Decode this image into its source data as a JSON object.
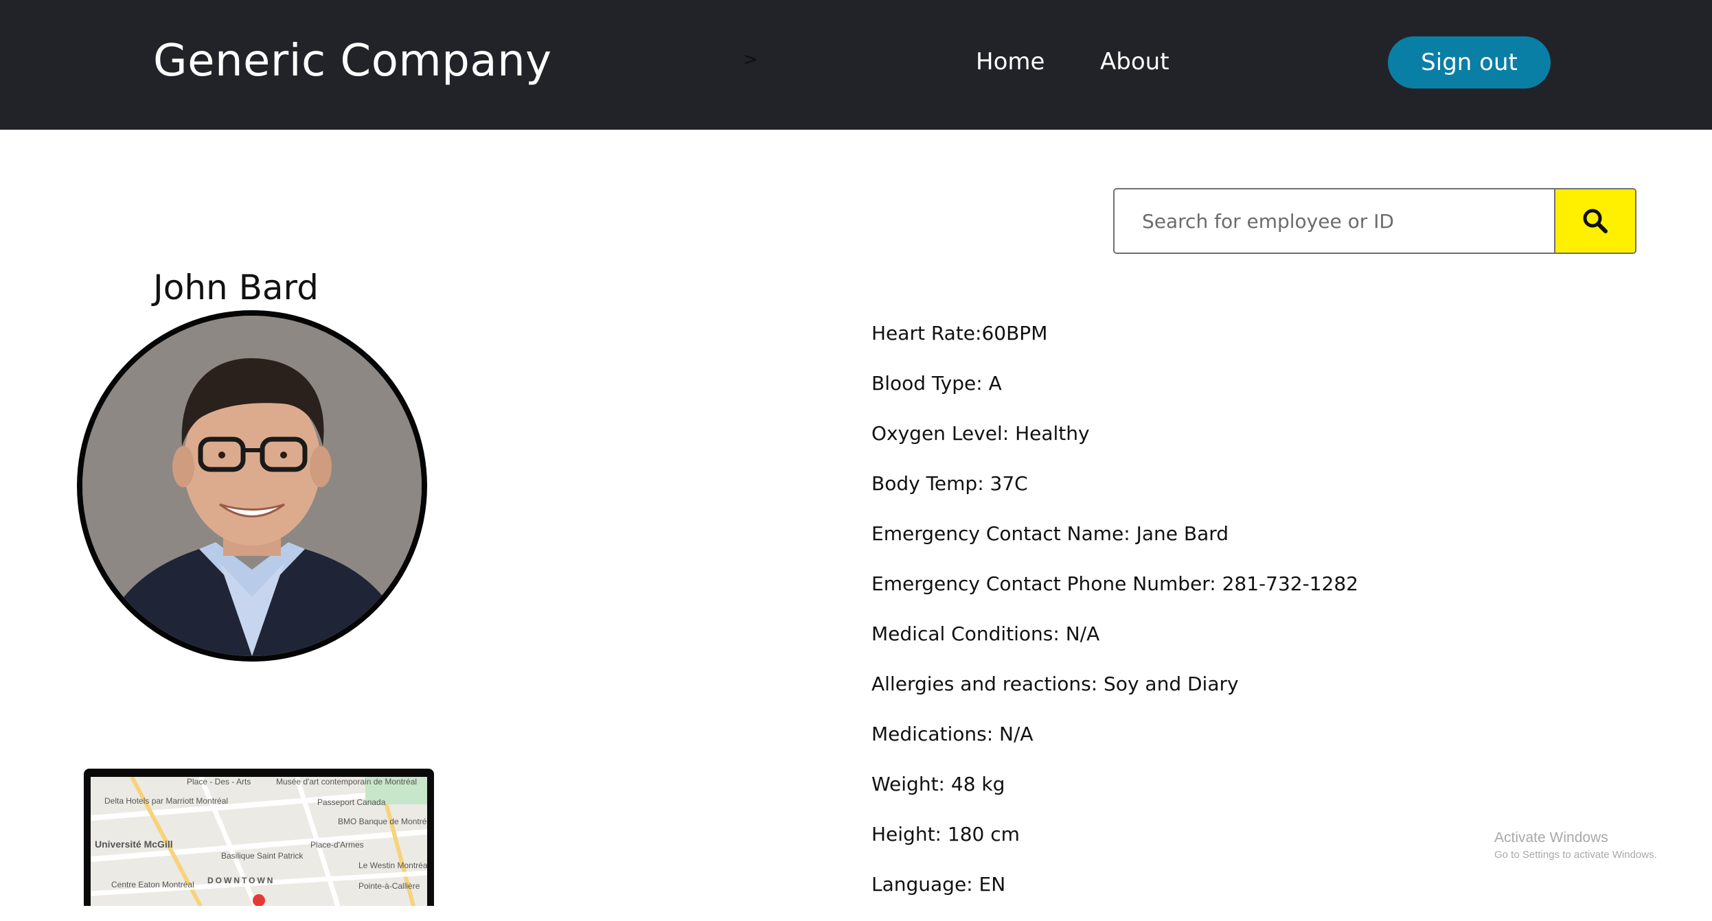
{
  "header": {
    "brand": "Generic Company",
    "caret": ">",
    "nav": [
      {
        "label": "Home"
      },
      {
        "label": "About"
      }
    ],
    "signout_label": "Sign out"
  },
  "search": {
    "placeholder": "Search for employee or ID",
    "button_icon": "search-icon"
  },
  "employee": {
    "name": "John Bard",
    "details": [
      "Heart Rate:60BPM",
      "Blood Type: A",
      "Oxygen Level: Healthy",
      "Body Temp: 37C",
      "Emergency Contact Name: Jane Bard",
      "Emergency Contact Phone Number: 281-732-1282",
      "Medical Conditions: N/A",
      "Allergies and reactions: Soy and Diary",
      "Medications: N/A",
      "Weight: 48 kg",
      "Height: 180 cm",
      "Language: EN"
    ]
  },
  "map": {
    "labels": [
      "Place - Des - Arts",
      "Musée d'art contemporain de Montréal",
      "Delta Hotels par Marriott Montréal",
      "Passeport Canada",
      "BMO Banque de Montréal",
      "Université McGill",
      "Basilique Saint Patrick",
      "Place-d'Armes",
      "Le Westin Montréal",
      "Centre Eaton Montréal",
      "DOWNTOWN",
      "Pointe-à-Callière"
    ]
  },
  "watermark": {
    "title": "Activate Windows",
    "subtitle": "Go to Settings to activate Windows."
  },
  "colors": {
    "navbar": "#222329",
    "signout": "#0a7fa5",
    "search_button": "#fff000"
  }
}
